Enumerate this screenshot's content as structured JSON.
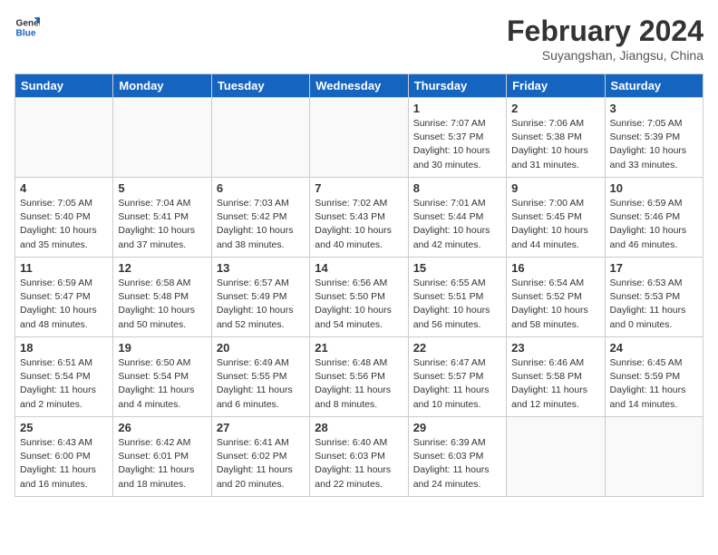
{
  "header": {
    "logo_line1": "General",
    "logo_line2": "Blue",
    "month": "February 2024",
    "location": "Suyangshan, Jiangsu, China"
  },
  "weekdays": [
    "Sunday",
    "Monday",
    "Tuesday",
    "Wednesday",
    "Thursday",
    "Friday",
    "Saturday"
  ],
  "weeks": [
    [
      {
        "day": "",
        "content": ""
      },
      {
        "day": "",
        "content": ""
      },
      {
        "day": "",
        "content": ""
      },
      {
        "day": "",
        "content": ""
      },
      {
        "day": "1",
        "content": "Sunrise: 7:07 AM\nSunset: 5:37 PM\nDaylight: 10 hours\nand 30 minutes."
      },
      {
        "day": "2",
        "content": "Sunrise: 7:06 AM\nSunset: 5:38 PM\nDaylight: 10 hours\nand 31 minutes."
      },
      {
        "day": "3",
        "content": "Sunrise: 7:05 AM\nSunset: 5:39 PM\nDaylight: 10 hours\nand 33 minutes."
      }
    ],
    [
      {
        "day": "4",
        "content": "Sunrise: 7:05 AM\nSunset: 5:40 PM\nDaylight: 10 hours\nand 35 minutes."
      },
      {
        "day": "5",
        "content": "Sunrise: 7:04 AM\nSunset: 5:41 PM\nDaylight: 10 hours\nand 37 minutes."
      },
      {
        "day": "6",
        "content": "Sunrise: 7:03 AM\nSunset: 5:42 PM\nDaylight: 10 hours\nand 38 minutes."
      },
      {
        "day": "7",
        "content": "Sunrise: 7:02 AM\nSunset: 5:43 PM\nDaylight: 10 hours\nand 40 minutes."
      },
      {
        "day": "8",
        "content": "Sunrise: 7:01 AM\nSunset: 5:44 PM\nDaylight: 10 hours\nand 42 minutes."
      },
      {
        "day": "9",
        "content": "Sunrise: 7:00 AM\nSunset: 5:45 PM\nDaylight: 10 hours\nand 44 minutes."
      },
      {
        "day": "10",
        "content": "Sunrise: 6:59 AM\nSunset: 5:46 PM\nDaylight: 10 hours\nand 46 minutes."
      }
    ],
    [
      {
        "day": "11",
        "content": "Sunrise: 6:59 AM\nSunset: 5:47 PM\nDaylight: 10 hours\nand 48 minutes."
      },
      {
        "day": "12",
        "content": "Sunrise: 6:58 AM\nSunset: 5:48 PM\nDaylight: 10 hours\nand 50 minutes."
      },
      {
        "day": "13",
        "content": "Sunrise: 6:57 AM\nSunset: 5:49 PM\nDaylight: 10 hours\nand 52 minutes."
      },
      {
        "day": "14",
        "content": "Sunrise: 6:56 AM\nSunset: 5:50 PM\nDaylight: 10 hours\nand 54 minutes."
      },
      {
        "day": "15",
        "content": "Sunrise: 6:55 AM\nSunset: 5:51 PM\nDaylight: 10 hours\nand 56 minutes."
      },
      {
        "day": "16",
        "content": "Sunrise: 6:54 AM\nSunset: 5:52 PM\nDaylight: 10 hours\nand 58 minutes."
      },
      {
        "day": "17",
        "content": "Sunrise: 6:53 AM\nSunset: 5:53 PM\nDaylight: 11 hours\nand 0 minutes."
      }
    ],
    [
      {
        "day": "18",
        "content": "Sunrise: 6:51 AM\nSunset: 5:54 PM\nDaylight: 11 hours\nand 2 minutes."
      },
      {
        "day": "19",
        "content": "Sunrise: 6:50 AM\nSunset: 5:54 PM\nDaylight: 11 hours\nand 4 minutes."
      },
      {
        "day": "20",
        "content": "Sunrise: 6:49 AM\nSunset: 5:55 PM\nDaylight: 11 hours\nand 6 minutes."
      },
      {
        "day": "21",
        "content": "Sunrise: 6:48 AM\nSunset: 5:56 PM\nDaylight: 11 hours\nand 8 minutes."
      },
      {
        "day": "22",
        "content": "Sunrise: 6:47 AM\nSunset: 5:57 PM\nDaylight: 11 hours\nand 10 minutes."
      },
      {
        "day": "23",
        "content": "Sunrise: 6:46 AM\nSunset: 5:58 PM\nDaylight: 11 hours\nand 12 minutes."
      },
      {
        "day": "24",
        "content": "Sunrise: 6:45 AM\nSunset: 5:59 PM\nDaylight: 11 hours\nand 14 minutes."
      }
    ],
    [
      {
        "day": "25",
        "content": "Sunrise: 6:43 AM\nSunset: 6:00 PM\nDaylight: 11 hours\nand 16 minutes."
      },
      {
        "day": "26",
        "content": "Sunrise: 6:42 AM\nSunset: 6:01 PM\nDaylight: 11 hours\nand 18 minutes."
      },
      {
        "day": "27",
        "content": "Sunrise: 6:41 AM\nSunset: 6:02 PM\nDaylight: 11 hours\nand 20 minutes."
      },
      {
        "day": "28",
        "content": "Sunrise: 6:40 AM\nSunset: 6:03 PM\nDaylight: 11 hours\nand 22 minutes."
      },
      {
        "day": "29",
        "content": "Sunrise: 6:39 AM\nSunset: 6:03 PM\nDaylight: 11 hours\nand 24 minutes."
      },
      {
        "day": "",
        "content": ""
      },
      {
        "day": "",
        "content": ""
      }
    ]
  ]
}
